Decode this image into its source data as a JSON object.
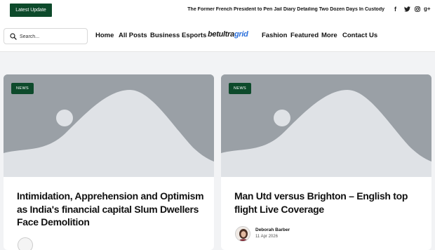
{
  "topbar": {
    "latest_label": "Latest Update",
    "ticker_text": "The Former French President to Pen Jail Diary Detailing Two Dozen Days In Custody",
    "social": [
      {
        "icon": "facebook-icon",
        "glyph": "f"
      },
      {
        "icon": "twitter-icon",
        "glyph": "t"
      },
      {
        "icon": "instagram-icon",
        "glyph": "ig"
      },
      {
        "icon": "google-plus-icon",
        "glyph": "g+"
      }
    ]
  },
  "nav": {
    "search_placeholder": "Search...",
    "items": [
      "Home",
      "All Posts",
      "Business",
      "Esports",
      "Fashion",
      "Featured",
      "More",
      "Contact Us"
    ],
    "logo_main": "betultra",
    "logo_accent": "grid"
  },
  "cards": [
    {
      "badge": "NEWS",
      "title": "Intimidation, Apprehension and Optimism as India's financial capital Slum Dwellers Face Demolition"
    },
    {
      "badge": "NEWS",
      "title": "Man Utd versus Brighton – English top flight Live Coverage",
      "author": "Deborah Barber",
      "date": "11 Apr 2026"
    }
  ],
  "colors": {
    "brand_green": "#0d4a2b",
    "placeholder_gray": "#9aa0a6",
    "placeholder_light": "#dfe2e6"
  }
}
